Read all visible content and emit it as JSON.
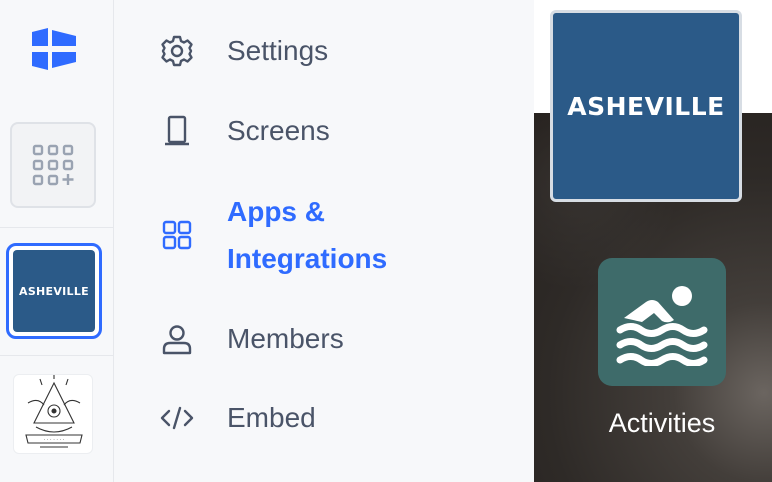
{
  "rail": {
    "logo_icon": "brand-logo-icon",
    "add_app_icon": "apps-grid-plus-icon",
    "active_org_label": "ASHEVILLE",
    "other_org_icon": "org-logo-seal"
  },
  "menu": {
    "items": [
      {
        "label": "Settings",
        "icon": "gear-icon"
      },
      {
        "label": "Screens",
        "icon": "screen-icon"
      },
      {
        "label": "Apps & Integrations",
        "icon": "grid-icon",
        "active": true
      },
      {
        "label": "Members",
        "icon": "user-icon"
      },
      {
        "label": "Embed",
        "icon": "code-icon"
      }
    ]
  },
  "preview": {
    "banner_label": "ASHEVILLE",
    "tile_label": "Activities",
    "tile_icon": "swimmer-icon"
  },
  "colors": {
    "accent": "#2f6bff",
    "menu_text": "#4a5468",
    "brand_blue": "#2b5a88",
    "tile_teal": "#3e6b6a"
  }
}
